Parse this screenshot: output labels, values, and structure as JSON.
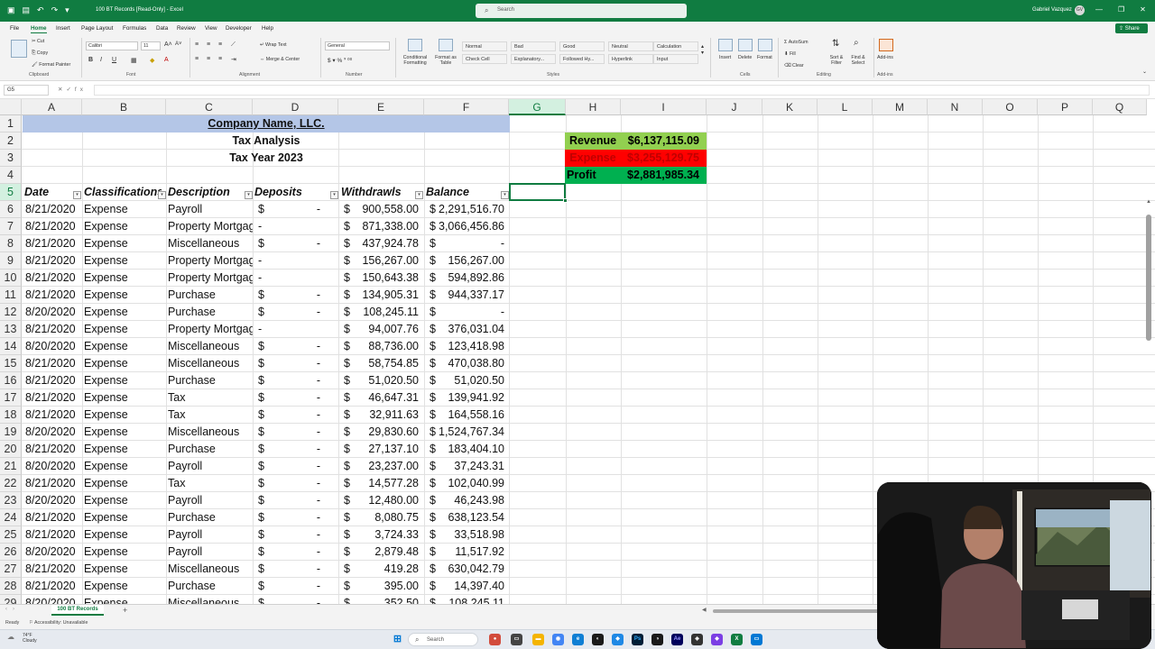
{
  "window": {
    "doc_title": "100 BT Records [Read-Only] - Excel",
    "search_placeholder": "Search",
    "user_name": "Gabriel Vazquez",
    "user_initials": "GV"
  },
  "menu": {
    "tabs": [
      "File",
      "Home",
      "Insert",
      "Page Layout",
      "Formulas",
      "Data",
      "Review",
      "View",
      "Developer",
      "Help"
    ],
    "active_tab": "Home",
    "share_label": "Share"
  },
  "ribbon": {
    "clipboard": {
      "cut": "Cut",
      "copy": "Copy",
      "format_painter": "Format Painter",
      "label": "Clipboard"
    },
    "font": {
      "name": "Calibri",
      "size": "11",
      "label": "Font"
    },
    "alignment": {
      "wrap_text": "Wrap Text",
      "merge_center": "Merge & Center",
      "label": "Alignment"
    },
    "number": {
      "format": "General",
      "label": "Number"
    },
    "styles": {
      "conditional": "Conditional Formatting",
      "format_table": "Format as Table",
      "cells": [
        {
          "text": "Normal",
          "bg": "#ffffff",
          "color": "#000000"
        },
        {
          "text": "Bad",
          "bg": "#ffc7ce",
          "color": "#9c0006"
        },
        {
          "text": "Good",
          "bg": "#c6efce",
          "color": "#006100"
        },
        {
          "text": "Neutral",
          "bg": "#ffeb9c",
          "color": "#9c5700"
        },
        {
          "text": "Calculation",
          "bg": "#f2f2f2",
          "color": "#fa7d00"
        },
        {
          "text": "Check Cell",
          "bg": "#a5a5a5",
          "color": "#ffffff"
        },
        {
          "text": "Explanatory...",
          "bg": "#ffffff",
          "color": "#7f7f7f"
        },
        {
          "text": "Followed Hy...",
          "bg": "#ffffff",
          "color": "#954f72"
        },
        {
          "text": "Hyperlink",
          "bg": "#ffffff",
          "color": "#0563c1"
        },
        {
          "text": "Input",
          "bg": "#ffcc99",
          "color": "#3f3f76"
        }
      ],
      "label": "Styles"
    },
    "cells": {
      "insert": "Insert",
      "delete": "Delete",
      "format": "Format",
      "label": "Cells"
    },
    "editing": {
      "autosum": "AutoSum",
      "fill": "Fill",
      "clear": "Clear",
      "sort_filter": "Sort & Filter",
      "find_select": "Find & Select",
      "label": "Editing"
    },
    "addins": {
      "addins": "Add-ins",
      "label": "Add-ins"
    }
  },
  "formula_bar": {
    "name_box": "G5",
    "fx": "fx",
    "formula": ""
  },
  "columns": [
    "A",
    "B",
    "C",
    "D",
    "E",
    "F",
    "G",
    "H",
    "I",
    "J",
    "K",
    "L",
    "M",
    "N",
    "O",
    "P",
    "Q"
  ],
  "rows": [
    "1",
    "2",
    "3",
    "4",
    "5",
    "6",
    "7",
    "8",
    "9",
    "10",
    "11",
    "12",
    "13",
    "14",
    "15",
    "16",
    "17",
    "18",
    "19",
    "20",
    "21",
    "22",
    "23",
    "24",
    "25",
    "26",
    "27",
    "28",
    "29"
  ],
  "sheet": {
    "company": "Company Name, LLC.",
    "subtitle": "Tax Analysis",
    "tax_year": "Tax Year 2023",
    "headers": [
      "Date",
      "Classifications",
      "Description",
      "Deposits",
      "Withdrawls",
      "Balance"
    ],
    "records": [
      {
        "date": "8/21/2020",
        "cls": "Expense",
        "desc": "Payroll",
        "dep": "-",
        "wd": "900,558.00",
        "bal": "2,291,516.70"
      },
      {
        "date": "8/21/2020",
        "cls": "Expense",
        "desc": "Property Mortgage",
        "dep": "-",
        "wd": "871,338.00",
        "bal": "3,066,456.86"
      },
      {
        "date": "8/21/2020",
        "cls": "Expense",
        "desc": "Miscellaneous",
        "dep": "-",
        "wd": "437,924.78",
        "bal": "-"
      },
      {
        "date": "8/21/2020",
        "cls": "Expense",
        "desc": "Property Mortgage",
        "dep": "-",
        "wd": "156,267.00",
        "bal": "156,267.00"
      },
      {
        "date": "8/21/2020",
        "cls": "Expense",
        "desc": "Property Mortgage",
        "dep": "-",
        "wd": "150,643.38",
        "bal": "594,892.86"
      },
      {
        "date": "8/21/2020",
        "cls": "Expense",
        "desc": "Purchase",
        "dep": "-",
        "wd": "134,905.31",
        "bal": "944,337.17"
      },
      {
        "date": "8/20/2020",
        "cls": "Expense",
        "desc": "Purchase",
        "dep": "-",
        "wd": "108,245.11",
        "bal": "-"
      },
      {
        "date": "8/21/2020",
        "cls": "Expense",
        "desc": "Property Mortgage",
        "dep": "-",
        "wd": "94,007.76",
        "bal": "376,031.04"
      },
      {
        "date": "8/20/2020",
        "cls": "Expense",
        "desc": "Miscellaneous",
        "dep": "-",
        "wd": "88,736.00",
        "bal": "123,418.98"
      },
      {
        "date": "8/21/2020",
        "cls": "Expense",
        "desc": "Miscellaneous",
        "dep": "-",
        "wd": "58,754.85",
        "bal": "470,038.80"
      },
      {
        "date": "8/21/2020",
        "cls": "Expense",
        "desc": "Purchase",
        "dep": "-",
        "wd": "51,020.50",
        "bal": "51,020.50"
      },
      {
        "date": "8/21/2020",
        "cls": "Expense",
        "desc": "Tax",
        "dep": "-",
        "wd": "46,647.31",
        "bal": "139,941.92"
      },
      {
        "date": "8/21/2020",
        "cls": "Expense",
        "desc": "Tax",
        "dep": "-",
        "wd": "32,911.63",
        "bal": "164,558.16"
      },
      {
        "date": "8/20/2020",
        "cls": "Expense",
        "desc": "Miscellaneous",
        "dep": "-",
        "wd": "29,830.60",
        "bal": "1,524,767.34"
      },
      {
        "date": "8/21/2020",
        "cls": "Expense",
        "desc": "Purchase",
        "dep": "-",
        "wd": "27,137.10",
        "bal": "183,404.10"
      },
      {
        "date": "8/20/2020",
        "cls": "Expense",
        "desc": "Payroll",
        "dep": "-",
        "wd": "23,237.00",
        "bal": "37,243.31"
      },
      {
        "date": "8/21/2020",
        "cls": "Expense",
        "desc": "Tax",
        "dep": "-",
        "wd": "14,577.28",
        "bal": "102,040.99"
      },
      {
        "date": "8/20/2020",
        "cls": "Expense",
        "desc": "Payroll",
        "dep": "-",
        "wd": "12,480.00",
        "bal": "46,243.98"
      },
      {
        "date": "8/21/2020",
        "cls": "Expense",
        "desc": "Purchase",
        "dep": "-",
        "wd": "8,080.75",
        "bal": "638,123.54"
      },
      {
        "date": "8/21/2020",
        "cls": "Expense",
        "desc": "Payroll",
        "dep": "-",
        "wd": "3,724.33",
        "bal": "33,518.98"
      },
      {
        "date": "8/20/2020",
        "cls": "Expense",
        "desc": "Payroll",
        "dep": "-",
        "wd": "2,879.48",
        "bal": "11,517.92"
      },
      {
        "date": "8/21/2020",
        "cls": "Expense",
        "desc": "Miscellaneous",
        "dep": "-",
        "wd": "419.28",
        "bal": "630,042.79"
      },
      {
        "date": "8/21/2020",
        "cls": "Expense",
        "desc": "Purchase",
        "dep": "-",
        "wd": "395.00",
        "bal": "14,397.40"
      },
      {
        "date": "8/20/2020",
        "cls": "Expense",
        "desc": "Miscellaneous",
        "dep": "-",
        "wd": "352.50",
        "bal": "108,245.11"
      }
    ],
    "summary": [
      {
        "label": "Revenue",
        "value": "$6,137,115.09",
        "bg": "#92d050",
        "color": "#000000"
      },
      {
        "label": "Expense",
        "value": "$3,255,129.75",
        "bg": "#ff0000",
        "color": "#c00000"
      },
      {
        "label": "Profit",
        "value": "$2,881,985.34",
        "bg": "#00b050",
        "color": "#000000"
      }
    ]
  },
  "sheet_tab": "100 BT Records",
  "status": {
    "ready": "Ready",
    "accessibility": "Accessibility: Unavailable"
  },
  "taskbar": {
    "weather_temp": "74°F",
    "weather_desc": "Cloudy",
    "search": "Search"
  },
  "colors": {
    "accent": "#107c41",
    "company_band": "#b4c6e7"
  }
}
